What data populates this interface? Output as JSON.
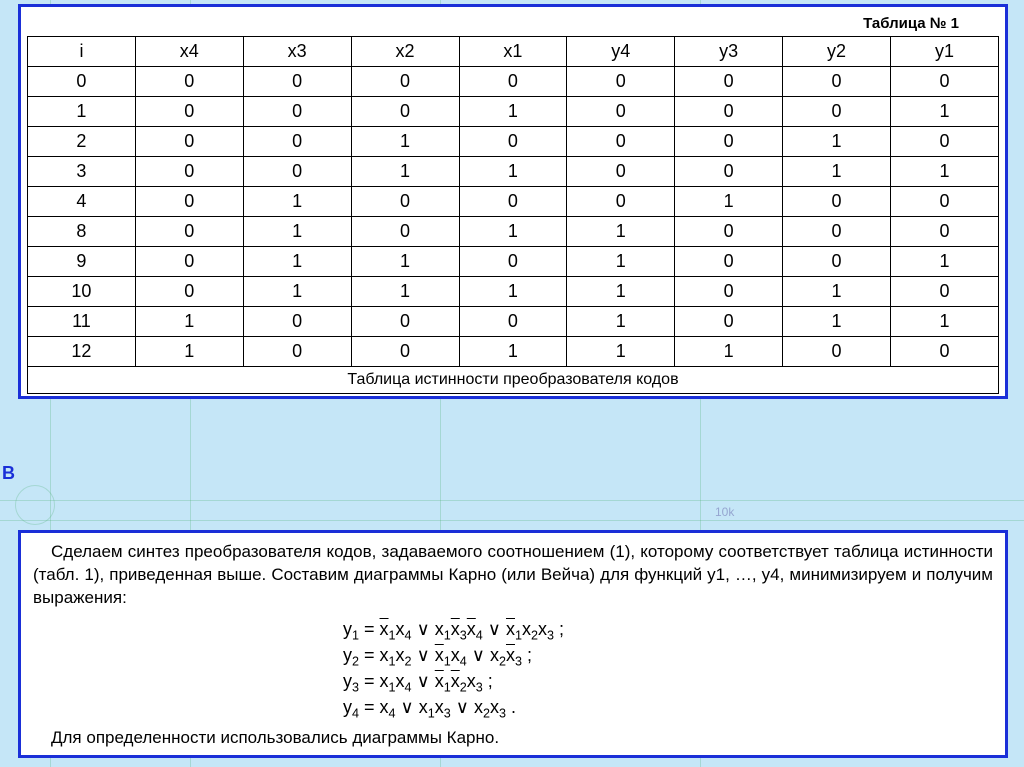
{
  "top": {
    "label": "Таблица № 1",
    "headers": [
      "i",
      "x4",
      "x3",
      "x2",
      "x1",
      "y4",
      "y3",
      "y2",
      "y1"
    ],
    "rows": [
      [
        "0",
        "0",
        "0",
        "0",
        "0",
        "0",
        "0",
        "0",
        "0"
      ],
      [
        "1",
        "0",
        "0",
        "0",
        "1",
        "0",
        "0",
        "0",
        "1"
      ],
      [
        "2",
        "0",
        "0",
        "1",
        "0",
        "0",
        "0",
        "1",
        "0"
      ],
      [
        "3",
        "0",
        "0",
        "1",
        "1",
        "0",
        "0",
        "1",
        "1"
      ],
      [
        "4",
        "0",
        "1",
        "0",
        "0",
        "0",
        "1",
        "0",
        "0"
      ],
      [
        "8",
        "0",
        "1",
        "0",
        "1",
        "1",
        "0",
        "0",
        "0"
      ],
      [
        "9",
        "0",
        "1",
        "1",
        "0",
        "1",
        "0",
        "0",
        "1"
      ],
      [
        "10",
        "0",
        "1",
        "1",
        "1",
        "1",
        "0",
        "1",
        "0"
      ],
      [
        "11",
        "1",
        "0",
        "0",
        "0",
        "1",
        "0",
        "1",
        "1"
      ],
      [
        "12",
        "1",
        "0",
        "0",
        "1",
        "1",
        "1",
        "0",
        "0"
      ]
    ],
    "caption": "Таблица истинности преобразователя кодов"
  },
  "stray_letter": "В",
  "bg_label": "10k",
  "bottom": {
    "para": "Сделаем синтез преобразователя кодов, задаваемого соотношением (1), которому соответствует таблица истинности (табл. 1), приведенная выше. Составим диаграммы Карно (или Вейча) для функций y1, …, y4, минимизируем и получим выражения:",
    "formulas": {
      "y1": "y₁ = x̄₁x₄ ∨ x₁x̄₃x̄₄ ∨ x̄₁x₂x₃ ;",
      "y2": "y₂ = x₁x₂ ∨ x̄₁x₄ ∨ x₂x̄₃ ;",
      "y3": "y₃ = x₁x₄ ∨ x̄₁x̄₂x₃ ;",
      "y4": "y₄ = x₄ ∨ x₁x₃ ∨ x₂x₃ ."
    },
    "footer": "Для определенности использовались диаграммы Карно."
  },
  "chart_data": {
    "type": "table",
    "title": "Таблица № 1 — Таблица истинности преобразователя кодов",
    "columns": [
      "i",
      "x4",
      "x3",
      "x2",
      "x1",
      "y4",
      "y3",
      "y2",
      "y1"
    ],
    "rows": [
      [
        0,
        0,
        0,
        0,
        0,
        0,
        0,
        0,
        0
      ],
      [
        1,
        0,
        0,
        0,
        1,
        0,
        0,
        0,
        1
      ],
      [
        2,
        0,
        0,
        1,
        0,
        0,
        0,
        1,
        0
      ],
      [
        3,
        0,
        0,
        1,
        1,
        0,
        0,
        1,
        1
      ],
      [
        4,
        0,
        1,
        0,
        0,
        0,
        1,
        0,
        0
      ],
      [
        8,
        0,
        1,
        0,
        1,
        1,
        0,
        0,
        0
      ],
      [
        9,
        0,
        1,
        1,
        0,
        1,
        0,
        0,
        1
      ],
      [
        10,
        0,
        1,
        1,
        1,
        1,
        0,
        1,
        0
      ],
      [
        11,
        1,
        0,
        0,
        0,
        1,
        0,
        1,
        1
      ],
      [
        12,
        1,
        0,
        0,
        1,
        1,
        1,
        0,
        0
      ]
    ]
  }
}
